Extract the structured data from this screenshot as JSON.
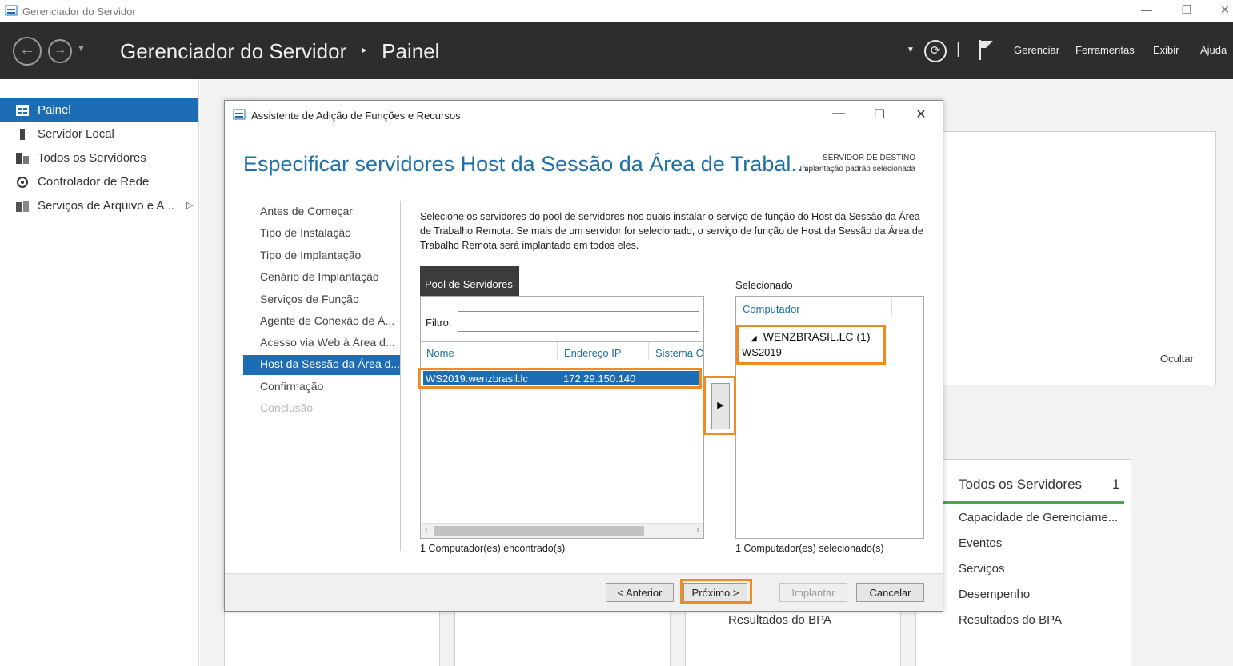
{
  "window": {
    "title": "Gerenciador do Servidor"
  },
  "header": {
    "title": "Gerenciador do Servidor",
    "separator": "‣",
    "page": "Painel",
    "menus": [
      "Gerenciar",
      "Ferramentas",
      "Exibir",
      "Ajuda"
    ]
  },
  "leftnav": {
    "items": [
      {
        "label": "Painel",
        "icon": "dashboard-icon",
        "active": true
      },
      {
        "label": "Servidor Local",
        "icon": "server-icon"
      },
      {
        "label": "Todos os Servidores",
        "icon": "servers-icon"
      },
      {
        "label": "Controlador de Rede",
        "icon": "network-controller-icon"
      },
      {
        "label": "Serviços de Arquivo e A...",
        "icon": "file-services-icon",
        "expandable": true
      }
    ]
  },
  "background": {
    "hide_label": "Ocultar",
    "tile": {
      "title": "Todos os Servidores",
      "count": "1",
      "items": [
        "Capacidade de Gerenciame...",
        "Eventos",
        "Serviços",
        "Desempenho",
        "Resultados do BPA"
      ]
    },
    "other_tile_item": "Resultados do BPA"
  },
  "dialog": {
    "title": "Assistente de Adição de Funções e Recursos",
    "page_title": "Especificar servidores Host da Sessão da Área de Trabal...",
    "destination_label": "SERVIDOR DE DESTINO",
    "destination_value": "Implantação padrão selecionada",
    "steps": [
      {
        "label": "Antes de Começar"
      },
      {
        "label": "Tipo de Instalação"
      },
      {
        "label": "Tipo de Implantação"
      },
      {
        "label": "Cenário de Implantação"
      },
      {
        "label": "Serviços de Função"
      },
      {
        "label": "Agente de Conexão de Á..."
      },
      {
        "label": "Acesso via Web à Área d..."
      },
      {
        "label": "Host da Sessão da Área d...",
        "active": true
      },
      {
        "label": "Confirmação"
      },
      {
        "label": "Conclusão",
        "disabled": true
      }
    ],
    "description": "Selecione os servidores do pool de servidores nos quais instalar o serviço de função do Host da Sessão da Área de Trabalho Remota. Se mais de um servidor for selecionado, o serviço de função de Host da Sessão da Área de Trabalho Remota será implantado em todos eles.",
    "pool": {
      "tab_label": "Pool de Servidores",
      "filter_label": "Filtro:",
      "filter_value": "",
      "columns": [
        "Nome",
        "Endereço IP",
        "Sistema C"
      ],
      "rows": [
        {
          "name": "WS2019.wenzbrasil.lc",
          "ip": "172.29.150.140",
          "os": ""
        }
      ],
      "found_text": "1 Computador(es) encontrado(s)"
    },
    "selected": {
      "label": "Selecionado",
      "column": "Computador",
      "group": "WENZBRASIL.LC (1)",
      "member": "WS2019",
      "count_text": "1 Computador(es) selecionado(s)"
    },
    "buttons": {
      "previous": "< Anterior",
      "next": "Próximo >",
      "deploy": "Implantar",
      "cancel": "Cancelar"
    }
  },
  "colors": {
    "accent": "#1d6db5",
    "header_bg": "#2d2d30",
    "highlight": "#f08a24",
    "title_blue": "#1e6ea7"
  }
}
